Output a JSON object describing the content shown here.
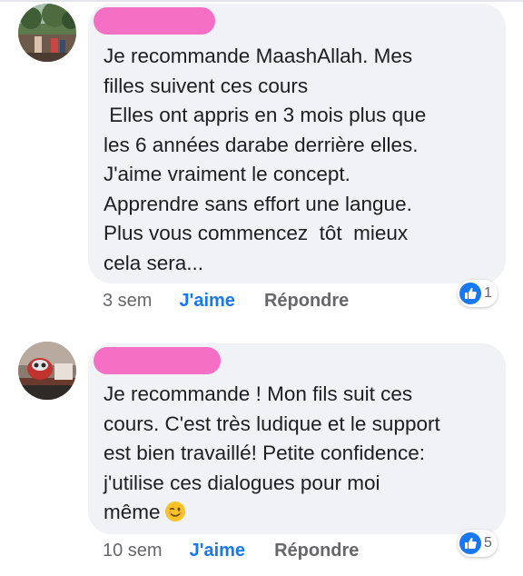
{
  "comments": [
    {
      "text": "Je recommande MaashAllah. Mes\nfilles suivent ces cours\n Elles ont appris en 3 mois plus que\nles 6 années darabe derrière elles.\nJ'aime vraiment le concept.\nApprendre sans effort une langue.\nPlus vous commencez  tôt  mieux\ncela sera...",
      "time": "3 sem",
      "like_label": "J'aime",
      "reply_label": "Répondre",
      "reaction_icon": "like-thumb-icon",
      "reaction_count": "1"
    },
    {
      "text": "Je recommande ! Mon fils suit ces\ncours. C'est très ludique et le support\nest bien travaillé! Petite confidence:\nj'utilise ces dialogues pour moi\nmême",
      "emoji": "wink-emoji",
      "time": "10 sem",
      "like_label": "J'aime",
      "reply_label": "Répondre",
      "reaction_icon": "like-thumb-icon",
      "reaction_count": "5"
    }
  ],
  "colors": {
    "bubble": "#f0f2f5",
    "redaction": "#f56fc4",
    "like_blue": "#1877f2",
    "meta_gray": "#65676b",
    "text": "#1c1e21"
  }
}
